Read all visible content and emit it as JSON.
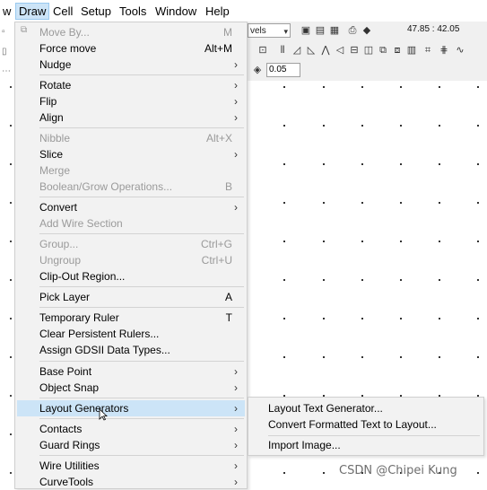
{
  "menubar": {
    "items": [
      "w",
      "Draw",
      "Cell",
      "Setup",
      "Tools",
      "Window",
      "Help"
    ]
  },
  "toolbar": {
    "units_combo": "vels",
    "coords": "47.85 : 42.05",
    "step_value": "0.05"
  },
  "draw_menu": {
    "items": [
      {
        "label": "Move By...",
        "shortcut": "M",
        "disabled": true
      },
      {
        "label": "Force move",
        "shortcut": "Alt+M"
      },
      {
        "label": "Nudge",
        "submenu": true
      },
      {
        "label": "Rotate",
        "submenu": true
      },
      {
        "label": "Flip",
        "submenu": true
      },
      {
        "label": "Align",
        "submenu": true
      },
      {
        "label": "Nibble",
        "shortcut": "Alt+X",
        "disabled": true
      },
      {
        "label": "Slice",
        "submenu": true
      },
      {
        "label": "Merge",
        "disabled": true
      },
      {
        "label": "Boolean/Grow Operations...",
        "shortcut": "B",
        "disabled": true
      },
      {
        "label": "Convert",
        "submenu": true
      },
      {
        "label": "Add Wire Section",
        "disabled": true
      },
      {
        "label": "Group...",
        "shortcut": "Ctrl+G",
        "disabled": true
      },
      {
        "label": "Ungroup",
        "shortcut": "Ctrl+U",
        "disabled": true
      },
      {
        "label": "Clip-Out Region..."
      },
      {
        "label": "Pick Layer",
        "shortcut": "A"
      },
      {
        "label": "Temporary Ruler",
        "shortcut": "T"
      },
      {
        "label": "Clear Persistent Rulers..."
      },
      {
        "label": "Assign GDSII Data Types..."
      },
      {
        "label": "Base Point",
        "submenu": true
      },
      {
        "label": "Object Snap",
        "submenu": true
      },
      {
        "label": "Layout Generators",
        "submenu": true,
        "highlighted": true
      },
      {
        "label": "Contacts",
        "submenu": true
      },
      {
        "label": "Guard Rings",
        "submenu": true
      },
      {
        "label": "Wire Utilities",
        "submenu": true
      },
      {
        "label": "CurveTools",
        "submenu": true
      }
    ]
  },
  "submenu": {
    "items": [
      "Layout Text Generator...",
      "Convert Formatted Text to Layout...",
      "Import Image..."
    ]
  },
  "watermark": "CSDN @Chipei Kung",
  "colors": {
    "highlight": "#cce4f7",
    "menu_bg": "#f2f2f2",
    "disabled_text": "#9a9a9a"
  }
}
